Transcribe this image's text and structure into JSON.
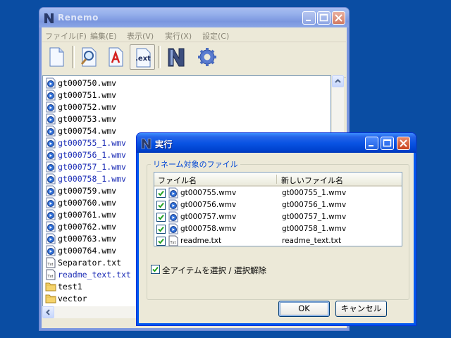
{
  "main_window": {
    "title": "Renemo",
    "menu": [
      "ファイル(F)",
      "編集(E)",
      "表示(V)",
      "実行(X)",
      "設定(C)"
    ],
    "toolbar_icons": [
      "new-document-icon",
      "search-icon",
      "text-edit-icon",
      "extension-icon",
      "renemo-logo-icon",
      "gear-icon"
    ],
    "toolbar_ext_label": ".ext",
    "files": [
      {
        "name": "gt000750.wmv",
        "type": "wmv",
        "renamed": false
      },
      {
        "name": "gt000751.wmv",
        "type": "wmv",
        "renamed": false
      },
      {
        "name": "gt000752.wmv",
        "type": "wmv",
        "renamed": false
      },
      {
        "name": "gt000753.wmv",
        "type": "wmv",
        "renamed": false
      },
      {
        "name": "gt000754.wmv",
        "type": "wmv",
        "renamed": false
      },
      {
        "name": "gt000755_1.wmv",
        "type": "wmv",
        "renamed": true
      },
      {
        "name": "gt000756_1.wmv",
        "type": "wmv",
        "renamed": true
      },
      {
        "name": "gt000757_1.wmv",
        "type": "wmv",
        "renamed": true
      },
      {
        "name": "gt000758_1.wmv",
        "type": "wmv",
        "renamed": true
      },
      {
        "name": "gt000759.wmv",
        "type": "wmv",
        "renamed": false
      },
      {
        "name": "gt000760.wmv",
        "type": "wmv",
        "renamed": false
      },
      {
        "name": "gt000761.wmv",
        "type": "wmv",
        "renamed": false
      },
      {
        "name": "gt000762.wmv",
        "type": "wmv",
        "renamed": false
      },
      {
        "name": "gt000763.wmv",
        "type": "wmv",
        "renamed": false
      },
      {
        "name": "gt000764.wmv",
        "type": "wmv",
        "renamed": false
      },
      {
        "name": "Separator.txt",
        "type": "txt",
        "renamed": false
      },
      {
        "name": "readme_text.txt",
        "type": "txt",
        "renamed": true
      },
      {
        "name": "test1",
        "type": "folder",
        "renamed": false
      },
      {
        "name": "vector",
        "type": "folder",
        "renamed": false
      }
    ]
  },
  "dialog": {
    "title": "実行",
    "group_title": "リネーム対象のファイル",
    "columns": [
      "ファイル名",
      "新しいファイル名"
    ],
    "rows": [
      {
        "old": "gt000755.wmv",
        "new": "gt000755_1.wmv",
        "checked": true,
        "type": "wmv"
      },
      {
        "old": "gt000756.wmv",
        "new": "gt000756_1.wmv",
        "checked": true,
        "type": "wmv"
      },
      {
        "old": "gt000757.wmv",
        "new": "gt000757_1.wmv",
        "checked": true,
        "type": "wmv"
      },
      {
        "old": "gt000758.wmv",
        "new": "gt000758_1.wmv",
        "checked": true,
        "type": "wmv"
      },
      {
        "old": "readme.txt",
        "new": "readme_text.txt",
        "checked": true,
        "type": "txt"
      }
    ],
    "select_all_label": "全アイテムを選択 / 選択解除",
    "select_all_checked": true,
    "ok_label": "OK",
    "cancel_label": "キャンセル"
  },
  "colors": {
    "desktop": "#0a4da3",
    "renamed_text": "#1a2bb5",
    "group_title": "#0046d5"
  }
}
